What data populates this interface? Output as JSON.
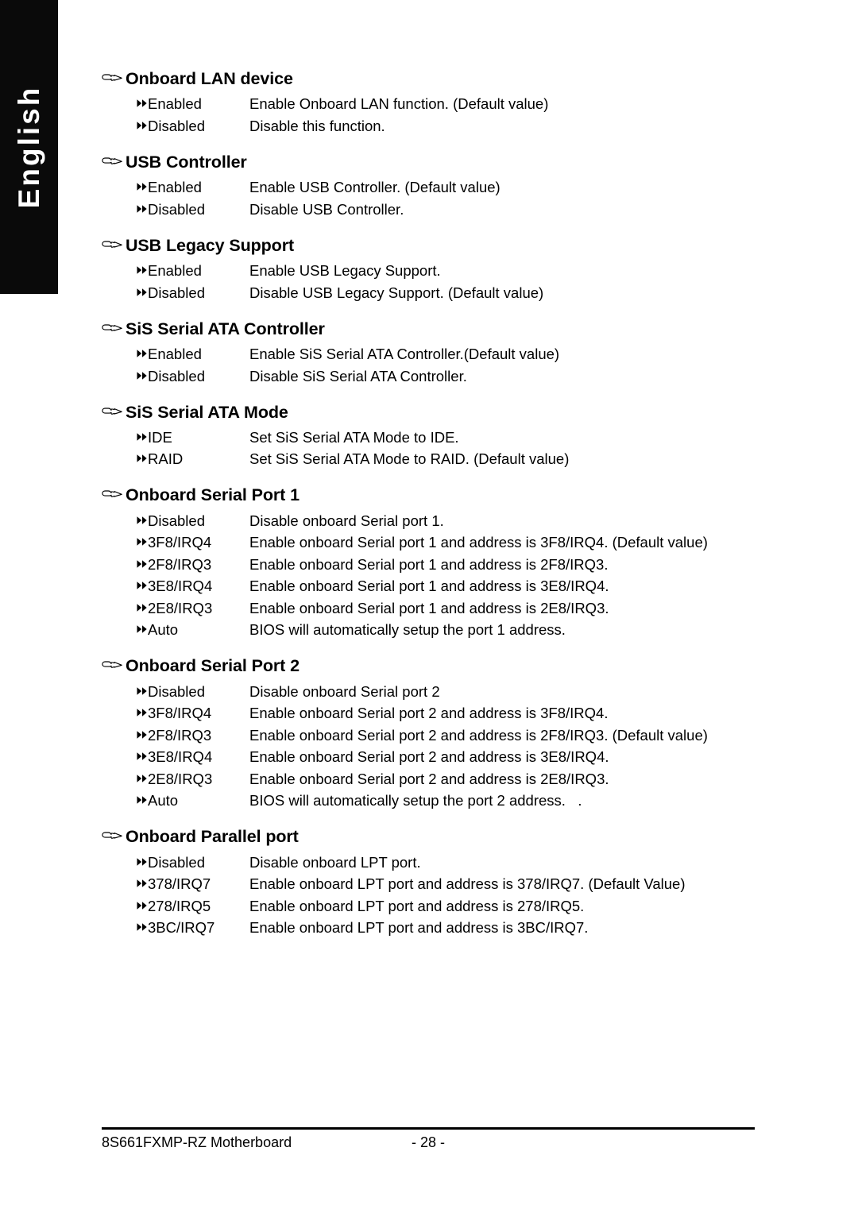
{
  "page": {
    "language_tab": "English",
    "footer_left": "8S661FXMP-RZ Motherboard",
    "footer_page": "- 28 -",
    "section_bullet_icon": "pointing-hand-icon",
    "option_bullet_icon": "double-triangle-right-icon"
  },
  "sections": [
    {
      "title": "Onboard LAN device",
      "options": [
        {
          "label": "Enabled",
          "desc": "Enable Onboard LAN function. (Default value)"
        },
        {
          "label": "Disabled",
          "desc": "Disable this function."
        }
      ]
    },
    {
      "title": "USB Controller",
      "options": [
        {
          "label": "Enabled",
          "desc": "Enable USB Controller. (Default value)"
        },
        {
          "label": "Disabled",
          "desc": "Disable USB Controller."
        }
      ]
    },
    {
      "title": "USB Legacy Support",
      "options": [
        {
          "label": "Enabled",
          "desc": "Enable USB Legacy Support."
        },
        {
          "label": "Disabled",
          "desc": "Disable USB Legacy Support. (Default value)"
        }
      ]
    },
    {
      "title": "SiS Serial ATA Controller",
      "options": [
        {
          "label": "Enabled",
          "desc": "Enable SiS Serial ATA Controller.(Default value)"
        },
        {
          "label": "Disabled",
          "desc": "Disable SiS Serial ATA Controller."
        }
      ]
    },
    {
      "title": "SiS Serial ATA Mode",
      "options": [
        {
          "label": "IDE",
          "desc": "Set SiS Serial ATA Mode to IDE."
        },
        {
          "label": "RAID",
          "desc": "Set SiS Serial ATA Mode to RAID. (Default value)"
        }
      ]
    },
    {
      "title": "Onboard Serial Port 1",
      "options": [
        {
          "label": "Disabled",
          "desc": "Disable onboard Serial port 1."
        },
        {
          "label": "3F8/IRQ4",
          "desc": "Enable onboard Serial port 1 and address is 3F8/IRQ4. (Default value)"
        },
        {
          "label": "2F8/IRQ3",
          "desc": "Enable onboard Serial port 1 and address is 2F8/IRQ3."
        },
        {
          "label": "3E8/IRQ4",
          "desc": "Enable onboard Serial port 1 and address is 3E8/IRQ4."
        },
        {
          "label": "2E8/IRQ3",
          "desc": "Enable onboard Serial port 1 and address is 2E8/IRQ3."
        },
        {
          "label": "Auto",
          "desc": "BIOS will automatically setup the port 1 address."
        }
      ]
    },
    {
      "title": "Onboard Serial Port 2",
      "options": [
        {
          "label": "Disabled",
          "desc": "Disable onboard Serial port 2"
        },
        {
          "label": "3F8/IRQ4",
          "desc": "Enable onboard Serial port 2 and address is 3F8/IRQ4."
        },
        {
          "label": "2F8/IRQ3",
          "desc": "Enable onboard Serial port 2 and address is 2F8/IRQ3. (Default value)"
        },
        {
          "label": "3E8/IRQ4",
          "desc": "Enable onboard Serial port 2 and address is 3E8/IRQ4."
        },
        {
          "label": "2E8/IRQ3",
          "desc": "Enable onboard Serial port 2 and address is 2E8/IRQ3."
        },
        {
          "label": "Auto",
          "desc": "BIOS will automatically setup the port 2 address.   ."
        }
      ]
    },
    {
      "title": "Onboard Parallel port",
      "options": [
        {
          "label": "Disabled",
          "desc": "Disable onboard LPT port."
        },
        {
          "label": "378/IRQ7",
          "desc": "Enable onboard LPT port and address is 378/IRQ7. (Default Value)"
        },
        {
          "label": "278/IRQ5",
          "desc": "Enable onboard LPT port and address is 278/IRQ5."
        },
        {
          "label": "3BC/IRQ7",
          "desc": "Enable onboard LPT port and address is 3BC/IRQ7."
        }
      ]
    }
  ]
}
